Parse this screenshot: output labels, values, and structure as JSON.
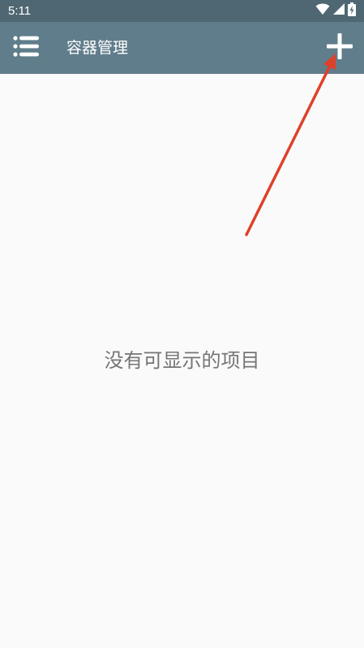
{
  "status_bar": {
    "time": "5:11",
    "icons": [
      "wifi-icon",
      "signal-icon",
      "battery-charging-icon"
    ]
  },
  "app_bar": {
    "menu_icon": "list-menu-icon",
    "title": "容器管理",
    "add_icon": "plus-icon"
  },
  "main": {
    "empty_message": "没有可显示的项目"
  },
  "annotation": {
    "color": "#e0402a",
    "icon": "arrow-annotation"
  },
  "colors": {
    "status_bar": "#4f6772",
    "app_bar": "#607d8b",
    "background": "#fafafa",
    "empty_text": "#757575"
  }
}
